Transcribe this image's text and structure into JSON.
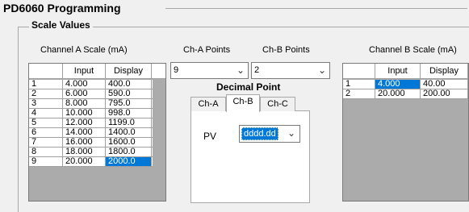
{
  "title": "PD6060 Programming",
  "scale_values_label": "Scale Values",
  "channel_a": {
    "caption": "Channel A Scale (mA)",
    "columns": [
      "Input",
      "Display"
    ],
    "rows": [
      [
        "1",
        "4.000",
        "400.0"
      ],
      [
        "2",
        "6.000",
        "590.0"
      ],
      [
        "3",
        "8.000",
        "795.0"
      ],
      [
        "4",
        "10.000",
        "998.0"
      ],
      [
        "5",
        "12.000",
        "1199.0"
      ],
      [
        "6",
        "14.000",
        "1400.0"
      ],
      [
        "7",
        "16.000",
        "1600.0"
      ],
      [
        "8",
        "18.000",
        "1800.0"
      ],
      [
        "9",
        "20.000",
        "2000.0"
      ]
    ]
  },
  "ch_a_points": {
    "label": "Ch-A Points",
    "value": "9"
  },
  "ch_b_points": {
    "label": "Ch-B Points",
    "value": "2"
  },
  "decimal_point": {
    "label": "Decimal Point",
    "tabs": [
      "Ch-A",
      "Ch-B",
      "Ch-C"
    ],
    "active_tab": "Ch-B",
    "pv_label": "PV",
    "pv_value": "dddd.dd"
  },
  "channel_b": {
    "caption": "Channel B Scale (mA)",
    "columns": [
      "Input",
      "Display"
    ],
    "rows": [
      [
        "1",
        "4.000",
        "40.00"
      ],
      [
        "2",
        "20.000",
        "200.00"
      ]
    ]
  },
  "colors": {
    "selection": "#0078d7",
    "grid_empty": "#ababab",
    "window": "#f0f0f0"
  },
  "icons": {
    "combo_arrow": "chevron-down-icon"
  }
}
